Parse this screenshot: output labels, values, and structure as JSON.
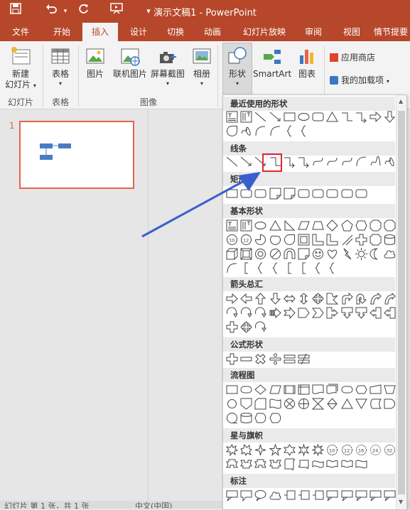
{
  "window": {
    "title": "演示文稿1 - PowerPoint"
  },
  "quick_access": {
    "save": "save-icon",
    "undo": "undo-icon",
    "redo": "redo-icon",
    "present": "present-icon",
    "customize": "▾"
  },
  "tabs": [
    "文件",
    "开始",
    "插入",
    "设计",
    "切换",
    "动画",
    "幻灯片放映",
    "审阅",
    "视图",
    "情节提要"
  ],
  "active_tab": "插入",
  "ribbon": {
    "new_slide": "新建\n幻灯片",
    "new_slide_l1": "新建",
    "new_slide_l2": "幻灯片",
    "table": "表格",
    "picture": "图片",
    "online_picture": "联机图片",
    "screenshot": "屏幕截图",
    "album": "相册",
    "shapes": "形状",
    "smartart": "SmartArt",
    "chart": "图表",
    "store": "应用商店",
    "my_addins": "我的加载项",
    "groups": {
      "slides": "幻灯片",
      "tables": "表格",
      "images": "图像"
    }
  },
  "slide_panel": {
    "slide_number": "1"
  },
  "status": {
    "text": "幻灯片 第 1 张，共 1 张",
    "lang": "中文(中国)"
  },
  "shapes_menu": {
    "sections": [
      {
        "label": "最近使用的形状"
      },
      {
        "label": "线条"
      },
      {
        "label": "矩形"
      },
      {
        "label": "基本形状"
      },
      {
        "label": "箭头总汇"
      },
      {
        "label": "公式形状"
      },
      {
        "label": "流程图"
      },
      {
        "label": "星与旗帜"
      },
      {
        "label": "标注"
      }
    ]
  },
  "colors": {
    "accent": "#b7472a",
    "highlight": "#e0262f",
    "arrow": "#3a5fcd",
    "thumb_border": "#e2654a"
  }
}
